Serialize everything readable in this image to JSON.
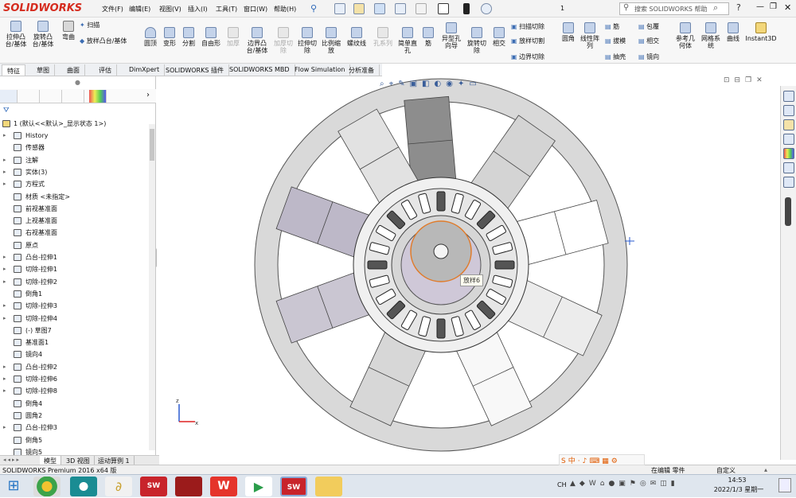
{
  "app": {
    "logo": "SOLIDWORKS",
    "menu": [
      "文件(F)",
      "编辑(E)",
      "视图(V)",
      "插入(I)",
      "工具(T)",
      "窗口(W)",
      "帮助(H)"
    ],
    "page_number": "1",
    "search_placeholder": "搜索 SOLIDWORKS 帮助"
  },
  "ribbon": {
    "buttons": [
      {
        "label": "拉伸凸\n台/基体",
        "enabled": true
      },
      {
        "label": "旋转凸\n台/基体",
        "enabled": true
      },
      {
        "label": "弯曲",
        "enabled": true
      },
      {
        "label": "圆顶",
        "enabled": true
      },
      {
        "label": "变形",
        "enabled": true
      },
      {
        "label": "分割",
        "enabled": true
      },
      {
        "label": "自由形",
        "enabled": true
      },
      {
        "label": "加厚",
        "enabled": false
      },
      {
        "label": "边界凸\n台/基体",
        "enabled": true
      },
      {
        "label": "加厚切\n除",
        "enabled": false
      },
      {
        "label": "拉伸切\n除",
        "enabled": true
      },
      {
        "label": "比例缩\n放",
        "enabled": true
      },
      {
        "label": "螺纹线",
        "enabled": true
      },
      {
        "label": "孔系列",
        "enabled": false
      },
      {
        "label": "简单直\n孔",
        "enabled": true
      },
      {
        "label": "筋",
        "enabled": true
      },
      {
        "label": "异型孔\n向导",
        "enabled": true
      },
      {
        "label": "旋转切\n除",
        "enabled": true
      },
      {
        "label": "相交",
        "enabled": true
      },
      {
        "label": "圆角",
        "enabled": true
      },
      {
        "label": "线性阵\n列",
        "enabled": true
      },
      {
        "label": "参考几\n何体",
        "enabled": true
      },
      {
        "label": "网格系\n统",
        "enabled": true
      },
      {
        "label": "曲线",
        "enabled": true
      },
      {
        "label": "Instant3D",
        "enabled": true
      }
    ],
    "side_items": [
      {
        "label": "扫描"
      },
      {
        "label": "放样凸台/基体"
      },
      {
        "label": "扫描切除"
      },
      {
        "label": "放样切割"
      },
      {
        "label": "边界切除"
      },
      {
        "label": "筋"
      },
      {
        "label": "包覆"
      },
      {
        "label": "拔模"
      },
      {
        "label": "相交"
      },
      {
        "label": "抽壳"
      },
      {
        "label": "镜向"
      }
    ]
  },
  "tabs": [
    "特征",
    "草图",
    "曲面",
    "评估",
    "DimXpert",
    "SOLIDWORKS 插件",
    "SOLIDWORKS MBD",
    "Flow Simulation",
    "分析准备"
  ],
  "tree": {
    "root": "1 (默认<<默认>_显示状态 1>)",
    "items": [
      {
        "label": "History",
        "arrow": "▸"
      },
      {
        "label": "传感器",
        "arrow": ""
      },
      {
        "label": "注解",
        "arrow": "▸"
      },
      {
        "label": "实体(3)",
        "arrow": "▸"
      },
      {
        "label": "方程式",
        "arrow": "▸"
      },
      {
        "label": "材质 <未指定>",
        "arrow": ""
      },
      {
        "label": "前视基准面",
        "arrow": ""
      },
      {
        "label": "上视基准面",
        "arrow": ""
      },
      {
        "label": "右视基准面",
        "arrow": ""
      },
      {
        "label": "原点",
        "arrow": ""
      },
      {
        "label": "凸台-拉伸1",
        "arrow": "▸"
      },
      {
        "label": "切除-拉伸1",
        "arrow": "▸"
      },
      {
        "label": "切除-拉伸2",
        "arrow": "▸"
      },
      {
        "label": "倒角1",
        "arrow": ""
      },
      {
        "label": "切除-拉伸3",
        "arrow": "▸"
      },
      {
        "label": "切除-拉伸4",
        "arrow": "▸"
      },
      {
        "label": "(-) 草图7",
        "arrow": ""
      },
      {
        "label": "基准面1",
        "arrow": ""
      },
      {
        "label": "镜向4",
        "arrow": ""
      },
      {
        "label": "凸台-拉伸2",
        "arrow": "▸"
      },
      {
        "label": "切除-拉伸6",
        "arrow": "▸"
      },
      {
        "label": "切除-拉伸8",
        "arrow": "▸"
      },
      {
        "label": "倒角4",
        "arrow": ""
      },
      {
        "label": "圆角2",
        "arrow": ""
      },
      {
        "label": "凸台-拉伸3",
        "arrow": "▸"
      },
      {
        "label": "倒角5",
        "arrow": ""
      },
      {
        "label": "镜向5",
        "arrow": ""
      }
    ]
  },
  "viewport": {
    "tooltip": "放样6"
  },
  "bottom_tabs": [
    "模型",
    "3D 视图",
    "运动算例 1"
  ],
  "status": {
    "left": "SOLIDWORKS Premium 2016 x64 版",
    "mode": "在编辑 零件",
    "units": "自定义"
  },
  "taskbar": {
    "apps": [
      "chrome",
      "arduino",
      "solidworks",
      "red-app",
      "wps",
      "play",
      "solidworks",
      "explorer"
    ],
    "tray_lang": "CH",
    "time": "14:53",
    "date": "2022/1/3 星期一"
  }
}
